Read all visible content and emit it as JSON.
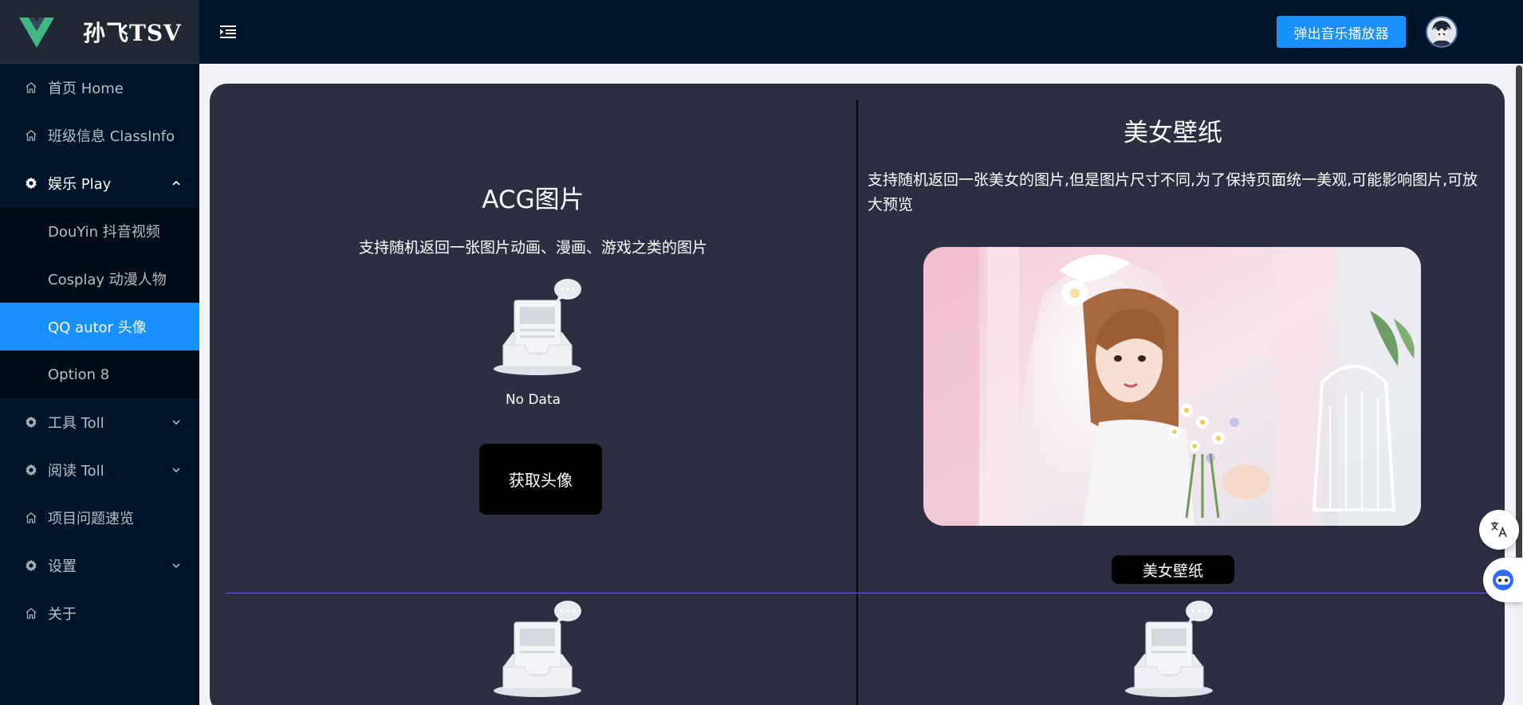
{
  "app": {
    "title": "孙飞TSV"
  },
  "sidebar": {
    "items": [
      {
        "label": "首页 Home",
        "icon": "home-icon"
      },
      {
        "label": "班级信息 ClassInfo",
        "icon": "home-icon"
      },
      {
        "label": "娱乐 Play",
        "icon": "gear-icon",
        "expanded": true,
        "children": [
          {
            "label": "DouYin 抖音视频"
          },
          {
            "label": "Cosplay 动漫人物"
          },
          {
            "label": "QQ autor 头像",
            "active": true
          },
          {
            "label": "Option 8"
          }
        ]
      },
      {
        "label": "工具 Toll",
        "icon": "gear-icon",
        "expanded": false
      },
      {
        "label": "阅读 Toll",
        "icon": "gear-icon",
        "expanded": false
      },
      {
        "label": "项目问题速览",
        "icon": "home-icon"
      },
      {
        "label": "设置",
        "icon": "gear-icon",
        "expanded": false
      },
      {
        "label": "关于",
        "icon": "home-icon"
      }
    ]
  },
  "header": {
    "music_button": "弹出音乐播放器"
  },
  "acg": {
    "title": "ACG图片",
    "description": "支持随机返回一张图片动画、漫画、游戏之类的图片",
    "empty_text": "No Data",
    "button": "获取头像"
  },
  "meinv": {
    "title": "美女壁纸",
    "description": "支持随机返回一张美女的图片,但是图片尺寸不同,为了保持页面统一美观,可能影响图片,可放大预览",
    "button": "美女壁纸"
  },
  "colors": {
    "sidebar_bg": "#001529",
    "submenu_bg": "#000c17",
    "accent": "#1890ff",
    "card_bg": "#2c2e42",
    "divider": "#6a5cff"
  }
}
